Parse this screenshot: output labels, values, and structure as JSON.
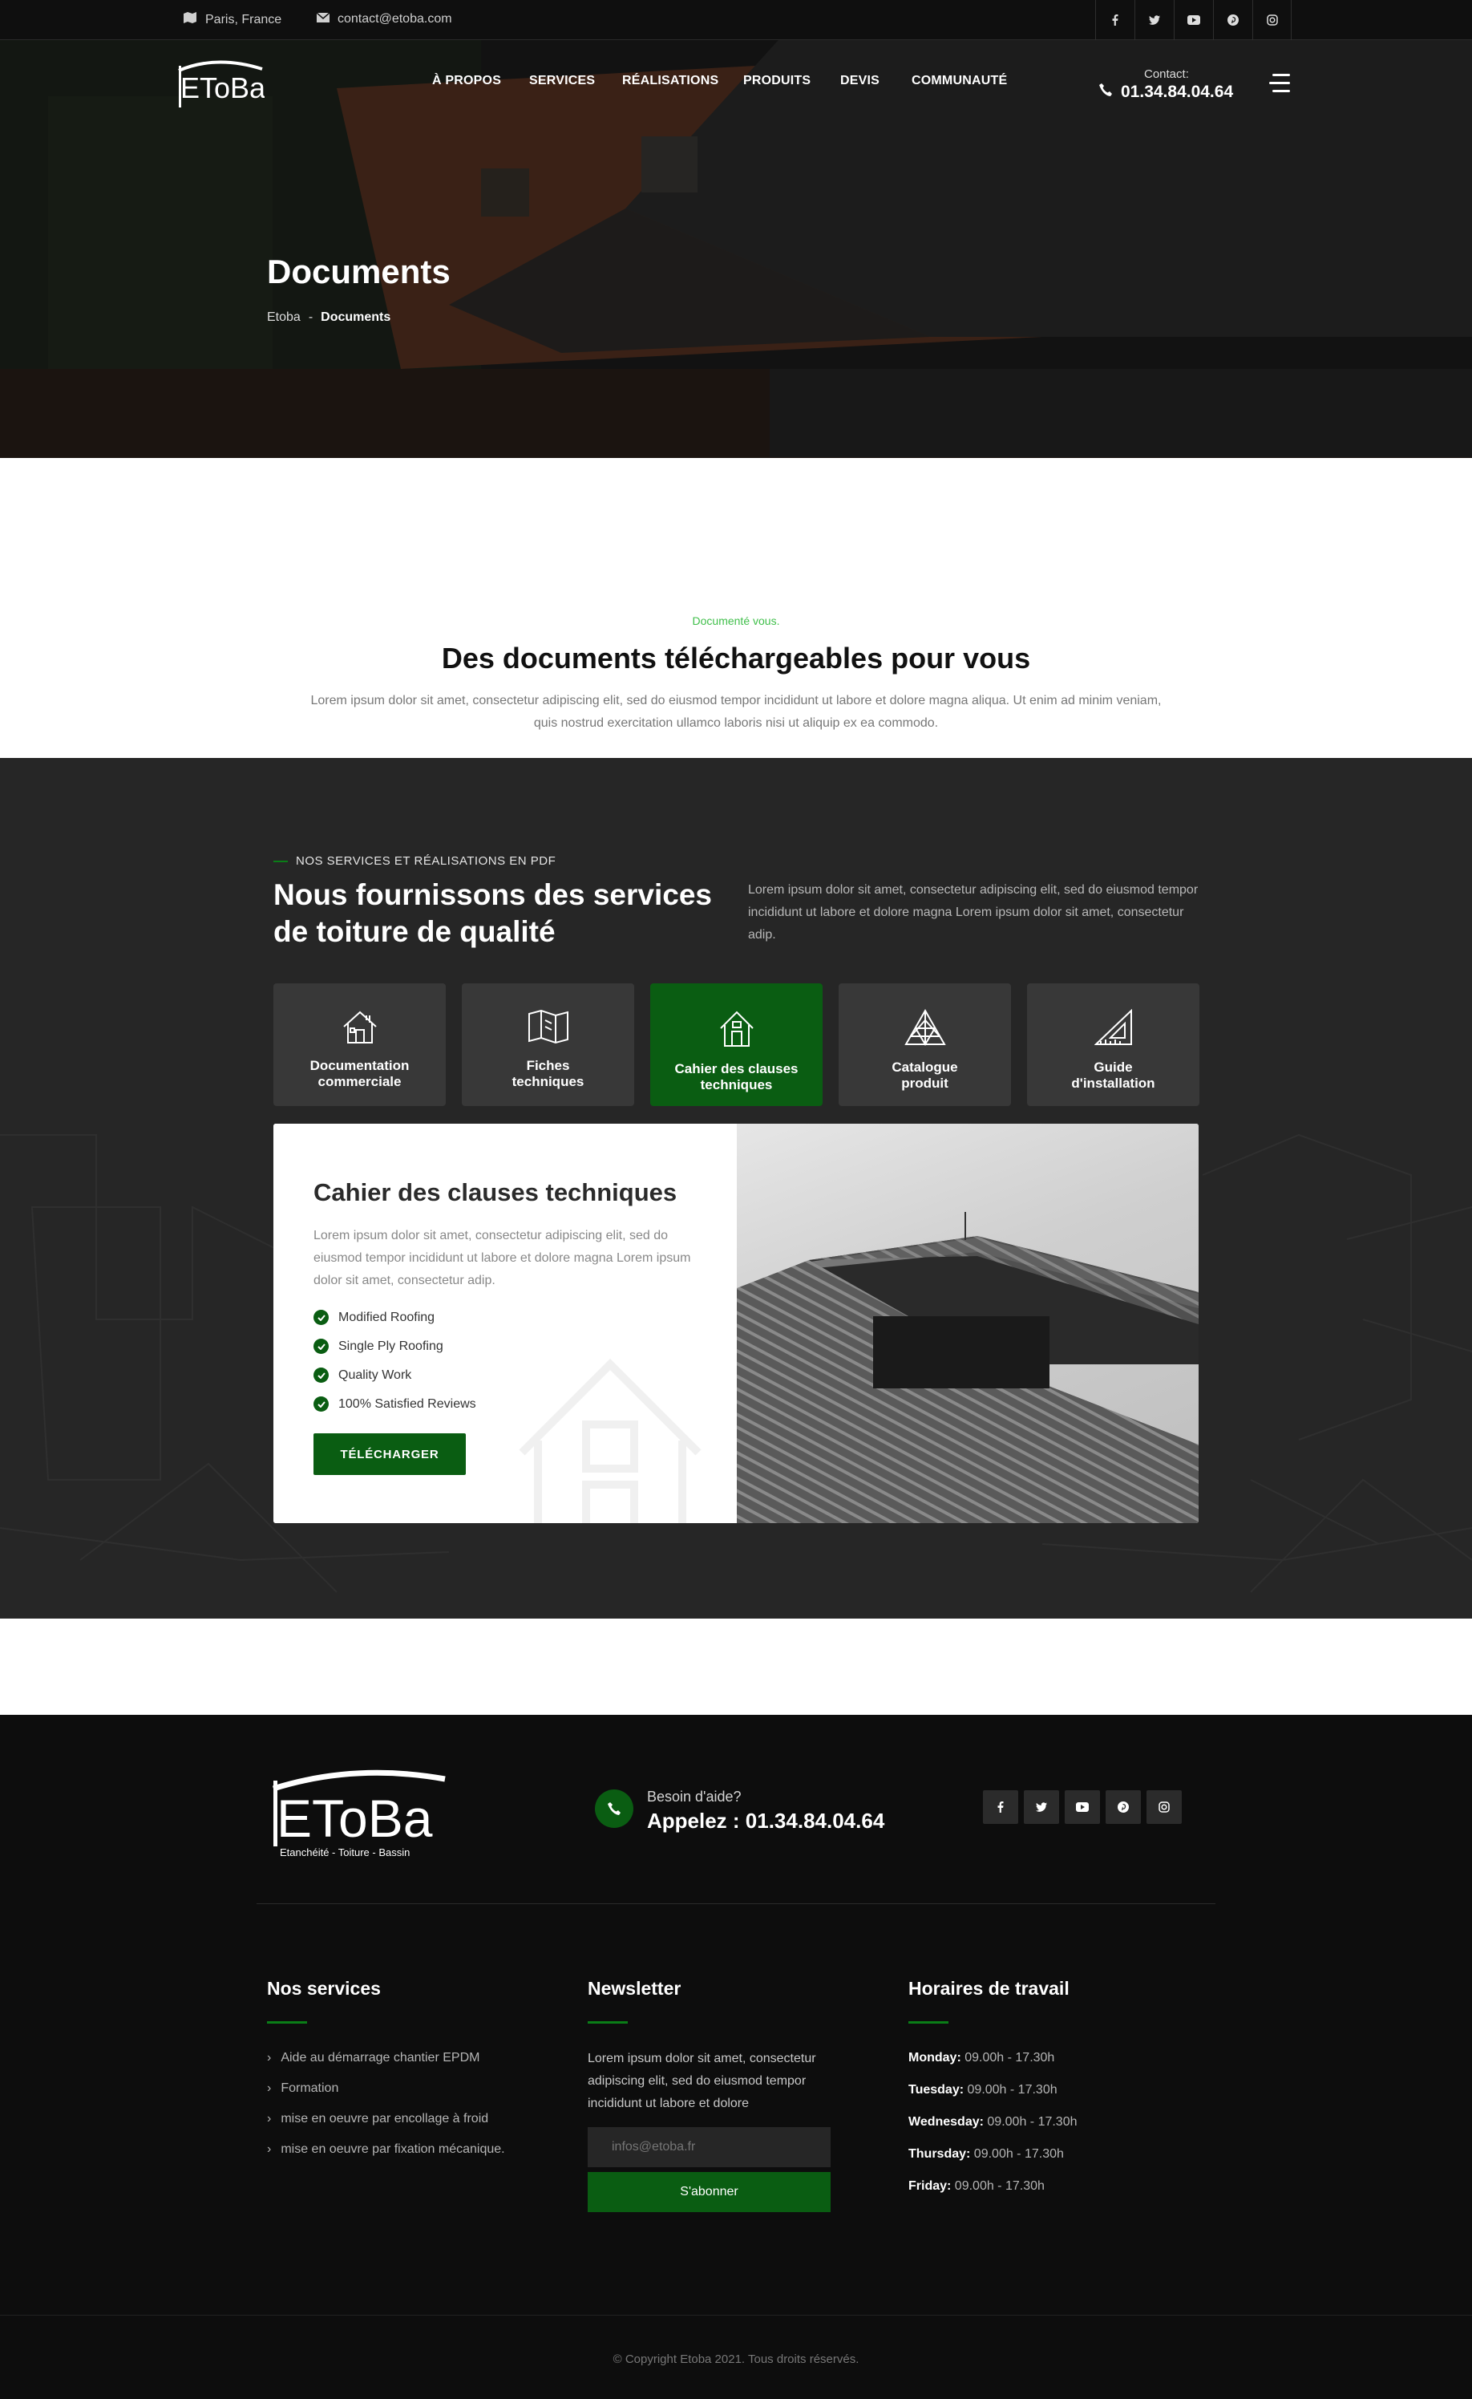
{
  "topbar": {
    "location": "Paris, France",
    "email": "contact@etoba.com",
    "social": [
      "facebook-icon",
      "twitter-icon",
      "youtube-icon",
      "pinterest-icon",
      "instagram-icon"
    ]
  },
  "brand": {
    "logo_text": "EToBa",
    "logo_tagline": "Etanchéité - Toiture - Bassin"
  },
  "nav": {
    "items": [
      "À PROPOS",
      "SERVICES",
      "RÉALISATIONS",
      "PRODUITS",
      "DEVIS",
      "COMMUNAUTÉ"
    ]
  },
  "header_contact": {
    "label": "Contact:",
    "phone": "01.34.84.04.64"
  },
  "hero": {
    "title": "Documents",
    "breadcrumb": [
      "Etoba",
      "-",
      "Documents"
    ]
  },
  "intro": {
    "kicker": "Documenté vous.",
    "title": "Des documents téléchargeables pour vous",
    "text": "Lorem ipsum dolor sit amet, consectetur adipiscing elit, sed do eiusmod tempor incididunt ut labore et dolore magna aliqua. Ut enim ad minim veniam, quis nostrud exercitation ullamco laboris nisi ut aliquip ex ea commodo."
  },
  "services": {
    "kicker": "NOS SERVICES ET RÉALISATIONS EN PDF",
    "title_line1": "Nous fournissons des services",
    "title_line2": "de toiture de qualité",
    "text": "Lorem ipsum dolor sit amet, consectetur adipiscing elit, sed do eiusmod tempor incididunt ut labore et dolore magna Lorem ipsum dolor sit amet, consectetur adip.",
    "tabs": [
      {
        "label": "Documentation\ncommerciale",
        "icon": "house-icon"
      },
      {
        "label": "Fiches\ntechniques",
        "icon": "map-icon"
      },
      {
        "label": "Cahier des clauses\ntechniques",
        "icon": "home-door-icon"
      },
      {
        "label": "Catalogue\nproduit",
        "icon": "roof-truss-icon"
      },
      {
        "label": "Guide\nd'installation",
        "icon": "set-square-icon"
      }
    ],
    "active_tab": 2
  },
  "card": {
    "title": "Cahier des clauses techniques",
    "text": "Lorem ipsum dolor sit amet, consectetur adipiscing elit, sed do eiusmod tempor incididunt ut labore et dolore magna Lorem ipsum dolor sit amet, consectetur adip.",
    "checks": [
      "Modified Roofing",
      "Single Ply Roofing",
      "Quality Work",
      "100% Satisfied Reviews"
    ],
    "button": "TÉLÉCHARGER"
  },
  "footer": {
    "help_label": "Besoin d'aide?",
    "help_phone": "Appelez : 01.34.84.04.64",
    "col1_title": "Nos services",
    "col1_links": [
      "Aide au démarrage chantier EPDM",
      "Formation",
      "mise en oeuvre par encollage à froid",
      "mise en oeuvre par fixation mécanique."
    ],
    "col2_title": "Newsletter",
    "col2_text": "Lorem ipsum dolor sit amet, consectetur adipiscing elit, sed do eiusmod tempor incididunt ut labore et dolore",
    "email_placeholder": "infos@etoba.fr",
    "subscribe": "S'abonner",
    "col3_title": "Horaires de travail",
    "hours": [
      {
        "day": "Monday:",
        "time": "09.00h - 17.30h"
      },
      {
        "day": "Tuesday:",
        "time": "09.00h - 17.30h"
      },
      {
        "day": "Wednesday:",
        "time": "09.00h - 17.30h"
      },
      {
        "day": "Thursday:",
        "time": "09.00h - 17.30h"
      },
      {
        "day": "Friday:",
        "time": "09.00h - 17.30h"
      }
    ],
    "copyright": "© Copyright Etoba 2021. Tous droits réservés."
  },
  "colors": {
    "accent": "#0a5d12",
    "dark": "#262626",
    "footer": "#0d0d0d"
  }
}
